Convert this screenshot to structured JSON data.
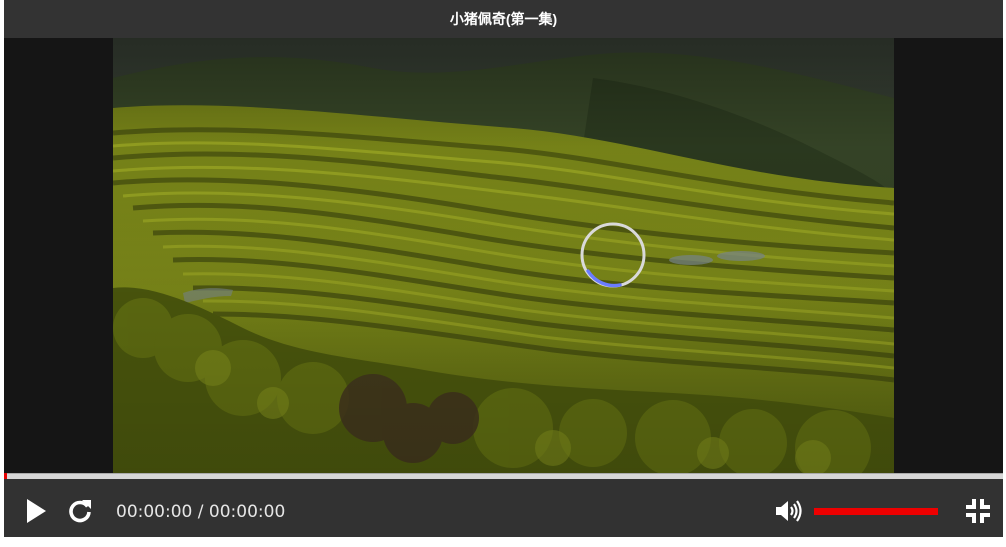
{
  "player": {
    "title": "小猪佩奇(第一集)",
    "video": {
      "state": "loading",
      "poster": "terraced rapeseed fields"
    },
    "progress": {
      "played_fraction": 0
    },
    "controls": {
      "play_icon": "play-icon",
      "replay_icon": "replay-icon",
      "current_time": "00:00:00",
      "separator": "/",
      "duration": "00:00:00",
      "volume_icon": "volume-icon",
      "volume_level": 1.0,
      "fullscreen_icon": "exit-fullscreen-icon"
    },
    "colors": {
      "accent": "#ee0000",
      "bar": "#323232",
      "title_bar": "#333333",
      "spinner_ring": "#d9d9d9",
      "spinner_arc": "#6a7cff"
    }
  }
}
